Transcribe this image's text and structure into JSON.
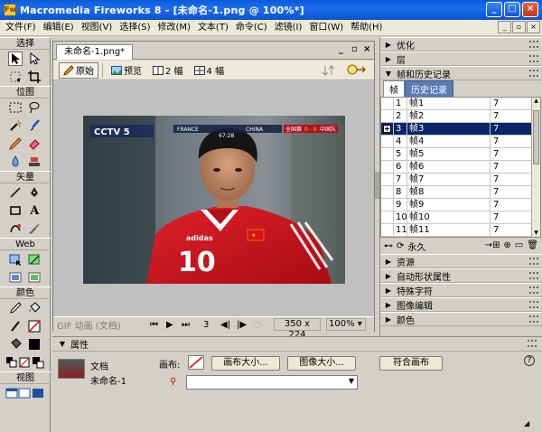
{
  "window": {
    "title": "Macromedia Fireworks 8 - [未命名-1.png @ 100%*]"
  },
  "menu": [
    "文件(F)",
    "编辑(E)",
    "视图(V)",
    "选择(S)",
    "修改(M)",
    "文本(T)",
    "命令(C)",
    "滤镜(I)",
    "窗口(W)",
    "帮助(H)"
  ],
  "toolbox": {
    "sections": [
      "选择",
      "位图",
      "矢量",
      "Web",
      "颜色",
      "视图"
    ]
  },
  "document": {
    "tab": "未命名-1.png*",
    "views": [
      "原始",
      "预览",
      "2 幅",
      "4 幅"
    ],
    "status": {
      "format": "GIF 动画 (文档)",
      "frame": "3",
      "size": "350 x 224",
      "zoom": "100%"
    },
    "photo": {
      "channel": "CCTV 5",
      "team_left": "FRANCE",
      "team_right": "CHINA",
      "time": "67:28",
      "score_note": "全国赛",
      "score": "0 - 0",
      "score_team": "中国队",
      "jersey_number": "10",
      "brand": "adidas"
    }
  },
  "panels": {
    "optimize": "优化",
    "layers": "层",
    "frames_history": "帧和历史记录",
    "tabs": [
      "帧",
      "历史记录"
    ],
    "frames": [
      {
        "num": "1",
        "name": "帧1",
        "delay": "7"
      },
      {
        "num": "2",
        "name": "帧2",
        "delay": "7"
      },
      {
        "num": "3",
        "name": "帧3",
        "delay": "7"
      },
      {
        "num": "4",
        "name": "帧4",
        "delay": "7"
      },
      {
        "num": "5",
        "name": "帧5",
        "delay": "7"
      },
      {
        "num": "6",
        "name": "帧6",
        "delay": "7"
      },
      {
        "num": "7",
        "name": "帧7",
        "delay": "7"
      },
      {
        "num": "8",
        "name": "帧8",
        "delay": "7"
      },
      {
        "num": "9",
        "name": "帧9",
        "delay": "7"
      },
      {
        "num": "10",
        "name": "帧10",
        "delay": "7"
      },
      {
        "num": "11",
        "name": "帧11",
        "delay": "7"
      }
    ],
    "selected_frame": 3,
    "loop": "永久",
    "collapsed": [
      "资源",
      "自动形状属性",
      "特殊字符",
      "图像编辑",
      "颜色"
    ]
  },
  "properties": {
    "title": "属性",
    "doc_label": "文档",
    "doc_name": "未命名-1",
    "canvas_label": "画布:",
    "canvas_size_btn": "画布大小...",
    "image_size_btn": "图像大小...",
    "fit_canvas_btn": "符合画布",
    "help": "?"
  },
  "colors": {
    "accent": "#0a246a",
    "jersey": "#c8141e"
  }
}
